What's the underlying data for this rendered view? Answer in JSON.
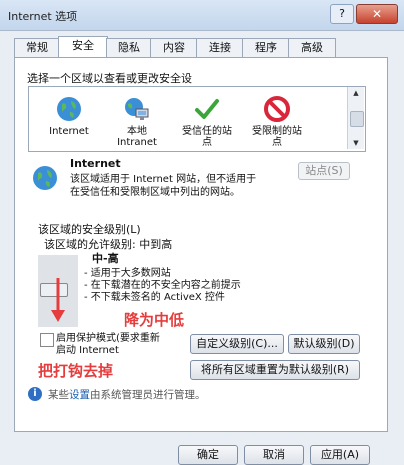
{
  "window": {
    "title": "Internet 选项",
    "help_label": "?",
    "close_label": "✕"
  },
  "tabs": [
    {
      "label": "常规"
    },
    {
      "label": "安全"
    },
    {
      "label": "隐私"
    },
    {
      "label": "内容"
    },
    {
      "label": "连接"
    },
    {
      "label": "程序"
    },
    {
      "label": "高级"
    }
  ],
  "security": {
    "zone_heading": "选择一个区域以查看或更改安全设",
    "zones": [
      {
        "label": "Internet",
        "icon": "globe-icon"
      },
      {
        "label": "本地\nIntranet",
        "icon": "intranet-icon"
      },
      {
        "label": "受信任的站\n点",
        "icon": "checkmark-icon"
      },
      {
        "label": "受限制的站\n点",
        "icon": "restricted-icon"
      }
    ],
    "selected_zone_title": "Internet",
    "selected_zone_desc": "该区域适用于 Internet 网站，但不适用于\n在受信任和受限制区域中列出的网站。",
    "sites_button": "站点(S)",
    "level_label": "该区域的安全级别(L)",
    "allowed_levels": "该区域的允许级别: 中到高",
    "level_name": "中-高",
    "level_bullets": [
      "- 适用于大多数网站",
      "- 在下载潜在的不安全内容之前提示",
      "- 不下载未签名的 ActiveX 控件"
    ],
    "annotation_lower": "降为中低",
    "annotation_uncheck": "把打钩去掉",
    "protected_mode_label": "启用保护模式(要求重新\n启动 Internet",
    "custom_level_button": "自定义级别(C)...",
    "default_level_button": "默认级别(D)",
    "reset_all_button": "将所有区域重置为默认级别(R)",
    "info_text_prefix": "某些",
    "info_link": "设置",
    "info_text_suffix": "由系统管理员进行管理。"
  },
  "footer": {
    "ok": "确定",
    "cancel": "取消",
    "apply": "应用(A)"
  },
  "colors": {
    "accent_red": "#e53d3d",
    "link_blue": "#1a5fb4"
  }
}
